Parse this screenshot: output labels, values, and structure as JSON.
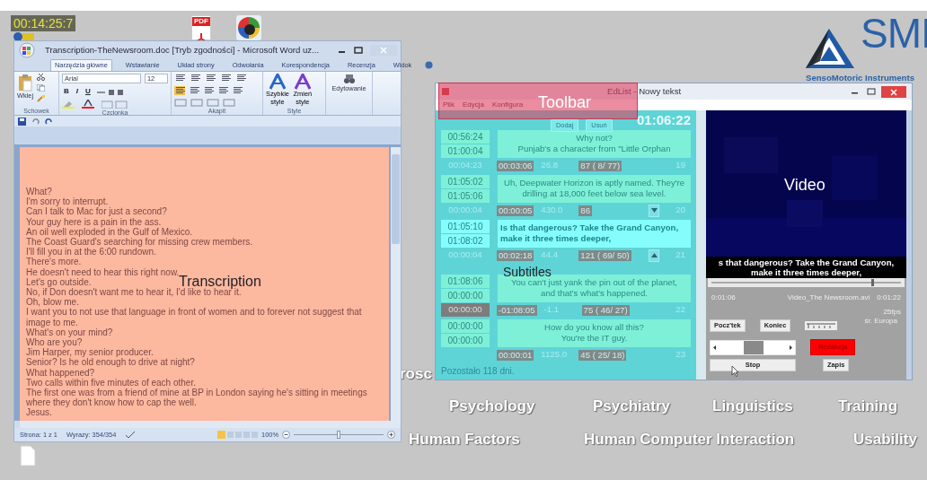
{
  "timer": "00:14:25:7",
  "desktop_icons": [
    {
      "kind": "pdf",
      "label": "PDF"
    },
    {
      "kind": "app"
    }
  ],
  "logo": {
    "name": "SMI",
    "tagline": "SensoMotoric Instruments"
  },
  "background_words": [
    [
      "rosc"
    ],
    [
      "Psychology",
      "Psychiatry",
      "Linguistics",
      "Training"
    ],
    [
      "Human Factors",
      "Human Computer Interaction",
      "Usability"
    ]
  ],
  "annotations": [
    {
      "kind": "transcription",
      "label": "Transcription"
    },
    {
      "kind": "toolbar",
      "label": "Toolbar"
    },
    {
      "kind": "subtitles",
      "label": "Subtitles"
    },
    {
      "kind": "video",
      "label": "Video"
    }
  ],
  "word": {
    "title": "Transcription-TheNewsroom.doc [Tryb zgodności] - Microsoft Word uz...",
    "tabs": [
      {
        "label": "Narzędzia główne",
        "selected": true
      },
      {
        "label": "Wstawianie",
        "selected": false
      },
      {
        "label": "Układ strony",
        "selected": false
      },
      {
        "label": "Odwołania",
        "selected": false
      },
      {
        "label": "Korespondencja",
        "selected": false
      },
      {
        "label": "Recenzja",
        "selected": false
      },
      {
        "label": "Widok",
        "selected": false
      }
    ],
    "ribbon": {
      "paste": "Wklej",
      "font": "Arial",
      "size": "12",
      "format_buttons": [
        "B",
        "I",
        "U"
      ],
      "quick_styles": [
        "Szybkie",
        "style"
      ],
      "change_styles": [
        "Zmień",
        "style"
      ],
      "editing": "Edytowanie",
      "groups": [
        "Schowek",
        "Czcionka",
        "Akapit",
        "Style"
      ]
    },
    "lines": [
      "What?",
      "I'm sorry to interrupt.",
      "Can I talk to Mac for just a second?",
      "Your guy here is a pain in the ass.",
      "An oil well exploded in the Gulf of Mexico.",
      "The Coast Guard's searching for missing crew members.",
      "I'll fill you in at the 6:00 rundown.",
      "There's more.",
      "He doesn't need to hear this right now.",
      "Let's go outside.",
      "No, if Don doesn't want me to hear it, I'd like to hear it.",
      "Oh, blow me.",
      "I want you to not use that language in front of women and to forever not suggest that image to me.",
      "What's on your mind?",
      "Who are you?",
      "Jim Harper, my senior producer.",
      "Senior? Is he old enough to drive at night?",
      "What happened?",
      "Two calls within five minutes of each other.",
      "The first one was from a friend of mine at BP in London saying he's sitting in meetings where they don't know how to cap the well.",
      "Jesus."
    ],
    "status": {
      "page": "Strona: 1 z 1",
      "words": "Wyrazy: 354/354",
      "zoom": "100%",
      "zoom_slider": {
        "level": 0.5
      }
    }
  },
  "edlist": {
    "title": "EdList - Nowy tekst",
    "menu": [
      "Plik",
      "Edycja",
      "Konfigura"
    ],
    "clock": "01:06:22",
    "buttons": [
      "Dodaj",
      "Usuń"
    ],
    "subtitles": [
      {
        "start": "00:56:24",
        "end": "01:00:04",
        "lines": [
          "Why not?",
          "Punjab's a character from \"Little Orphan"
        ],
        "selected": false,
        "duration": "00:04:23",
        "marked": false,
        "shift": "00:03:06",
        "rate": "26.8",
        "chars": "87 ( 8/ 77)",
        "number": "19",
        "scroll_down": false,
        "scroll_up": false
      },
      {
        "start": "01:05:02",
        "end": "01:05:06",
        "lines": [
          "Uh, Deepwater Horizon is aptly named. They're",
          "drilling at 18,000 feet below sea level."
        ],
        "selected": false,
        "duration": "00:00:04",
        "marked": false,
        "shift": "00:00:05",
        "rate": "430.0",
        "chars": "86",
        "number": "20",
        "scroll_down": true,
        "scroll_up": false
      },
      {
        "start": "01:05:10",
        "end": "01:08:02",
        "lines": [
          "Is that dangerous? Take the Grand Canyon,",
          "make it three times deeper,"
        ],
        "selected": true,
        "duration": "00:00:04",
        "marked": false,
        "shift": "00:02:18",
        "rate": "44.4",
        "chars": "121 ( 69/ 50)",
        "number": "21",
        "scroll_down": false,
        "scroll_up": true
      },
      {
        "start": "01:08:06",
        "end": "00:00:00",
        "lines": [
          "You can't just yank the pin out of the planet,",
          "and that's what's happened."
        ],
        "selected": false,
        "duration": "00:00:00",
        "marked": true,
        "shift": "-01:08:05",
        "rate": "-1.1",
        "chars": "75 ( 46/ 27)",
        "number": "22",
        "scroll_down": false,
        "scroll_up": false
      },
      {
        "start": "00:00:00",
        "end": "00:00:00",
        "lines": [
          "How do you know all this?",
          "You're the IT guy."
        ],
        "selected": false,
        "marked": false,
        "shift": "00:00:01",
        "rate": "1125.0",
        "chars": "45 ( 25/ 18)",
        "number": "23",
        "scroll_down": false,
        "scroll_up": false
      }
    ],
    "footer": "Pozostało 118 dni.",
    "video_subtitle": [
      "s that dangerous? Take the Grand Canyon,",
      "make it three times deeper,"
    ],
    "position": {
      "level": 0.83
    },
    "time_start": "0:01:06",
    "file": "Video_The Newsroom.avi",
    "time_end": "0:01:22",
    "fps": "25fps",
    "region": "śr. Europa",
    "controls": {
      "start": "Pocz'tek",
      "end": "Koniec",
      "edit": "Redakcja",
      "stop": "Stop",
      "save": "Zapis"
    }
  }
}
